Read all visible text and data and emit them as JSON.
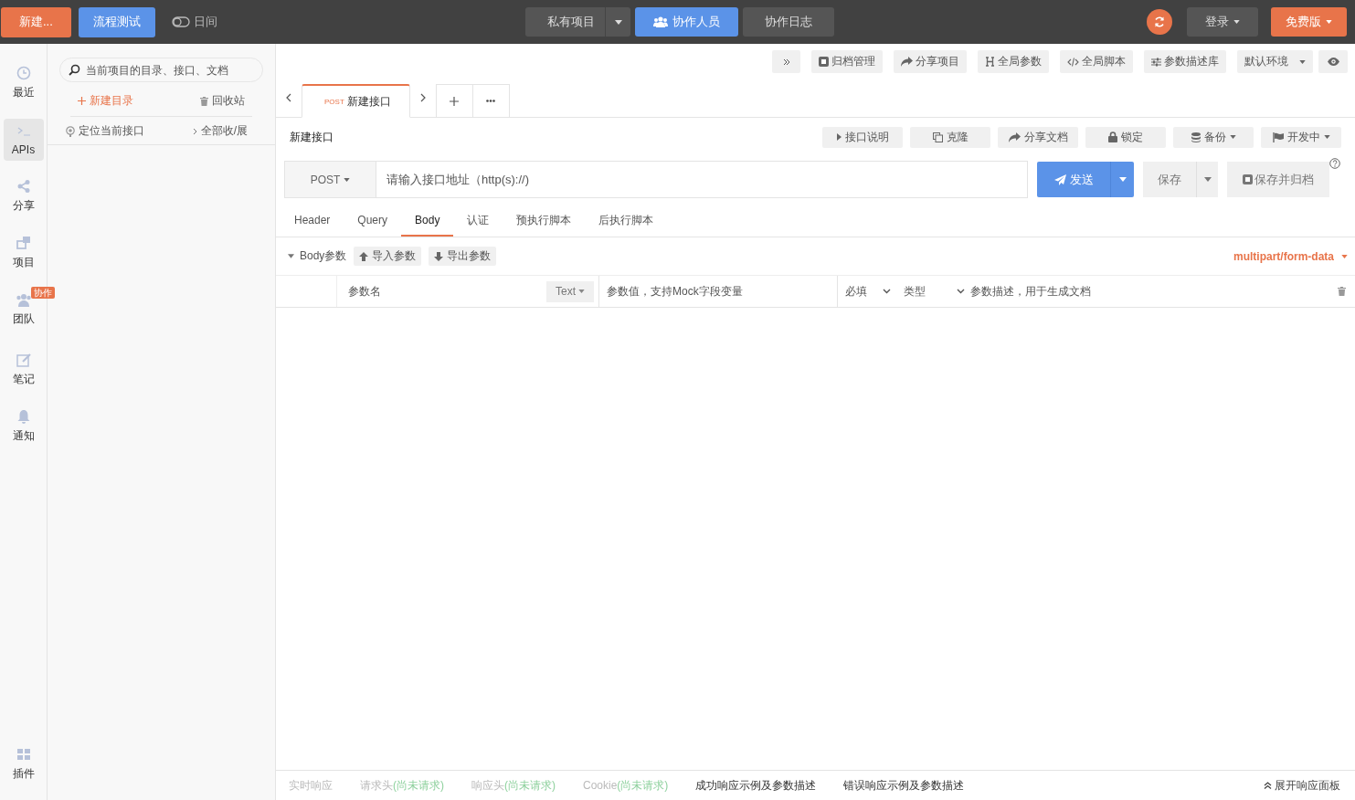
{
  "top_bar": {
    "new_button": "新建...",
    "flow_button": "流程测试",
    "theme_toggle": {
      "label": "日间",
      "on": false
    },
    "center": [
      {
        "label": "私有项目",
        "kind": "dropdown",
        "selected": false
      },
      {
        "label": "协作人员",
        "kind": "people",
        "selected": true
      },
      {
        "label": "协作日志",
        "kind": "plain",
        "selected": false
      }
    ],
    "login": "登录",
    "plan": "免费版"
  },
  "rail": [
    {
      "label": "最近",
      "selected": false
    },
    {
      "label": "APIs",
      "selected": true
    },
    {
      "label": "分享",
      "selected": false
    },
    {
      "label": "项目",
      "selected": false
    },
    {
      "label": "团队",
      "selected": false,
      "badge": "协作"
    },
    {
      "label": "笔记",
      "selected": false
    },
    {
      "label": "通知",
      "selected": false
    },
    {
      "label": "插件",
      "selected": false
    }
  ],
  "nav": {
    "search_placeholder": "当前项目的目录、接口、文档",
    "new_folder": "新建目录",
    "recycle": "回收站",
    "locate": "定位当前接口",
    "toggle_all": "全部收/展"
  },
  "toolbar": [
    {
      "label": "归档管理",
      "kind": "plain"
    },
    {
      "label": "分享项目",
      "kind": "plain"
    },
    {
      "label": "全局参数",
      "kind": "plain"
    },
    {
      "label": "全局脚本",
      "kind": "plain"
    },
    {
      "label": "参数描述库",
      "kind": "plain"
    },
    {
      "label": "默认环境",
      "kind": "dropdown"
    }
  ],
  "tabs": [
    {
      "method": "POST",
      "label": "新建接口",
      "selected": true
    }
  ],
  "api": {
    "name": "新建接口",
    "actions": [
      {
        "label": "接口说明",
        "kind": "plain"
      },
      {
        "label": "克隆",
        "kind": "plain"
      },
      {
        "label": "分享文档",
        "kind": "plain"
      },
      {
        "label": "锁定",
        "kind": "plain"
      },
      {
        "label": "备份",
        "kind": "dropdown"
      },
      {
        "label": "开发中",
        "kind": "dropdown"
      }
    ]
  },
  "request": {
    "method": "POST",
    "url_placeholder": "请输入接口地址（http(s)://)",
    "send": "发送",
    "save": "保存",
    "save_archive": "保存并归档"
  },
  "request_tabs": [
    {
      "label": "Header",
      "selected": false
    },
    {
      "label": "Query",
      "selected": false
    },
    {
      "label": "Body",
      "selected": true
    },
    {
      "label": "认证",
      "selected": false
    },
    {
      "label": "预执行脚本",
      "selected": false
    },
    {
      "label": "后执行脚本",
      "selected": false
    }
  ],
  "body": {
    "label": "Body参数",
    "expanded": true,
    "import": "导入参数",
    "export": "导出参数",
    "content_type": "multipart/form-data"
  },
  "param_row": {
    "name_placeholder": "参数名",
    "type": "Text",
    "value_placeholder": "参数值，支持Mock字段变量",
    "required": "必填",
    "type_label": "类型",
    "desc_placeholder": "参数描述，用于生成文档"
  },
  "response_tabs": [
    {
      "label": "实时响应",
      "disabled": true
    },
    {
      "label": "请求头",
      "note": "(尚未请求)",
      "disabled": true
    },
    {
      "label": "响应头",
      "note": "(尚未请求)",
      "disabled": true
    },
    {
      "label": "Cookie",
      "note": "(尚未请求)",
      "disabled": true
    },
    {
      "label": "成功响应示例及参数描述",
      "disabled": false
    },
    {
      "label": "错误响应示例及参数描述",
      "disabled": false
    }
  ],
  "expand_panel": "展开响应面板"
}
